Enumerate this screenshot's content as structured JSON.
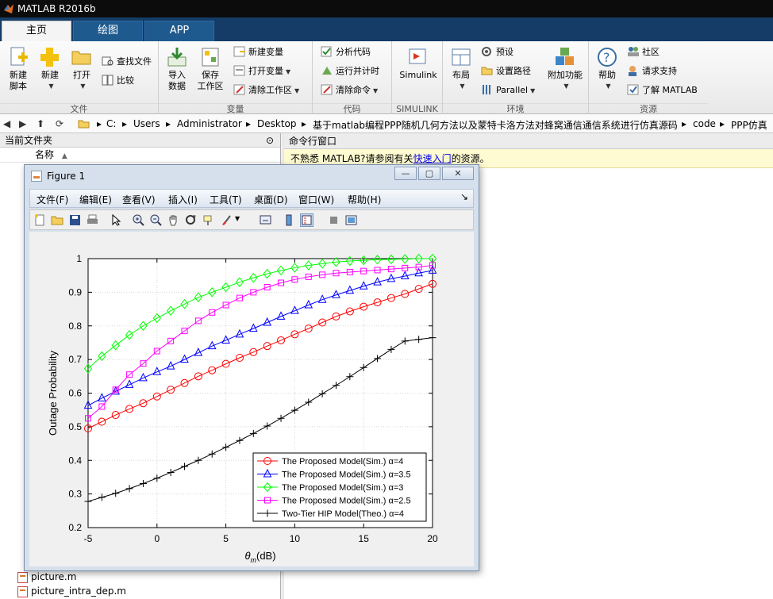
{
  "window": {
    "title": "MATLAB R2016b"
  },
  "tabs": [
    {
      "label": "主页"
    },
    {
      "label": "绘图"
    },
    {
      "label": "APP"
    }
  ],
  "ribbon": {
    "file": {
      "label": "文件",
      "new_script_1": "新建",
      "new_script_2": "脚本",
      "new": "新建",
      "open": "打开",
      "find_files": "查找文件",
      "compare": "比较"
    },
    "variable": {
      "label": "变量",
      "import_1": "导入",
      "import_2": "数据",
      "save_ws_1": "保存",
      "save_ws_2": "工作区",
      "new_var": "新建变量",
      "open_var": "打开变量",
      "clear_ws": "清除工作区"
    },
    "code": {
      "label": "代码",
      "analyze": "分析代码",
      "run_time": "运行并计时",
      "clear_cmd": "清除命令"
    },
    "simulink": {
      "label": "SIMULINK",
      "btn": "Simulink"
    },
    "env": {
      "label": "环境",
      "layout": "布局",
      "prefs": "预设",
      "set_path": "设置路径",
      "parallel": "Parallel",
      "addons": "附加功能"
    },
    "resources": {
      "label": "资源",
      "help": "帮助",
      "community": "社区",
      "support": "请求支持",
      "learn": "了解 MATLAB"
    }
  },
  "address": {
    "crumbs": [
      "C:",
      "Users",
      "Administrator",
      "Desktop",
      "基于matlab编程PPP随机几何方法以及蒙特卡洛方法对蜂窝通信通信系统进行仿真源码",
      "code",
      "PPP仿真"
    ]
  },
  "current_folder": {
    "title": "当前文件夹",
    "column": "名称",
    "files": [
      "picture.m",
      "picture_intra_dep.m"
    ]
  },
  "command_window": {
    "title": "命令行窗口",
    "tip_prefix": "不熟悉 MATLAB?请参阅有关",
    "tip_link": "快速入门",
    "tip_suffix": "的资源。"
  },
  "figure": {
    "title": "Figure 1",
    "menu": [
      "文件(F)",
      "编辑(E)",
      "查看(V)",
      "插入(I)",
      "工具(T)",
      "桌面(D)",
      "窗口(W)",
      "帮助(H)"
    ]
  },
  "chart_data": {
    "type": "line",
    "xlabel": "θm(dB)",
    "ylabel": "Outage Probability",
    "xlim": [
      -5,
      20
    ],
    "ylim": [
      0.2,
      1
    ],
    "xticks": [
      -5,
      0,
      5,
      10,
      15,
      20
    ],
    "yticks": [
      0.2,
      0.3,
      0.4,
      0.5,
      0.6,
      0.7,
      0.8,
      0.9,
      1
    ],
    "grid": true,
    "legend_position": "bottom-right",
    "x": [
      -5,
      -4,
      -3,
      -2,
      -1,
      0,
      1,
      2,
      3,
      4,
      5,
      6,
      7,
      8,
      9,
      10,
      11,
      12,
      13,
      14,
      15,
      16,
      17,
      18,
      19,
      20
    ],
    "series": [
      {
        "name": "The Proposed Model(Sim.) α=4",
        "color": "#ff0000",
        "marker": "circle",
        "values": [
          0.495,
          0.515,
          0.535,
          0.553,
          0.57,
          0.59,
          0.61,
          0.63,
          0.65,
          0.668,
          0.687,
          0.705,
          0.722,
          0.74,
          0.757,
          0.775,
          0.792,
          0.81,
          0.828,
          0.843,
          0.857,
          0.87,
          0.883,
          0.895,
          0.91,
          0.925
        ]
      },
      {
        "name": "The Proposed Model(Sim.) α=3.5",
        "color": "#0000ff",
        "marker": "triangle",
        "values": [
          0.563,
          0.585,
          0.605,
          0.625,
          0.645,
          0.663,
          0.68,
          0.7,
          0.72,
          0.74,
          0.757,
          0.775,
          0.792,
          0.81,
          0.828,
          0.845,
          0.862,
          0.878,
          0.892,
          0.905,
          0.918,
          0.93,
          0.94,
          0.948,
          0.957,
          0.965
        ]
      },
      {
        "name": "The Proposed Model(Sim.) α=3",
        "color": "#00ff00",
        "marker": "diamond",
        "values": [
          0.673,
          0.71,
          0.742,
          0.773,
          0.8,
          0.823,
          0.845,
          0.865,
          0.885,
          0.9,
          0.915,
          0.93,
          0.943,
          0.955,
          0.965,
          0.973,
          0.98,
          0.985,
          0.99,
          0.993,
          0.995,
          0.997,
          0.998,
          0.999,
          1.0,
          1.0
        ]
      },
      {
        "name": "The Proposed Model(Sim.) α=2.5",
        "color": "#ff00ff",
        "marker": "square",
        "values": [
          0.525,
          0.56,
          0.61,
          0.655,
          0.688,
          0.725,
          0.755,
          0.785,
          0.815,
          0.84,
          0.862,
          0.883,
          0.9,
          0.915,
          0.928,
          0.938,
          0.946,
          0.952,
          0.957,
          0.96,
          0.963,
          0.966,
          0.969,
          0.972,
          0.975,
          0.98
        ]
      },
      {
        "name": "Two-Tier HIP Model(Theo.) α=4",
        "color": "#000000",
        "marker": "plus",
        "values": [
          0.278,
          0.29,
          0.302,
          0.316,
          0.331,
          0.347,
          0.364,
          0.382,
          0.4,
          0.419,
          0.439,
          0.459,
          0.48,
          0.502,
          0.525,
          0.549,
          0.573,
          0.598,
          0.623,
          0.649,
          0.676,
          0.703,
          0.73,
          0.755,
          0.76,
          0.765
        ]
      }
    ]
  }
}
